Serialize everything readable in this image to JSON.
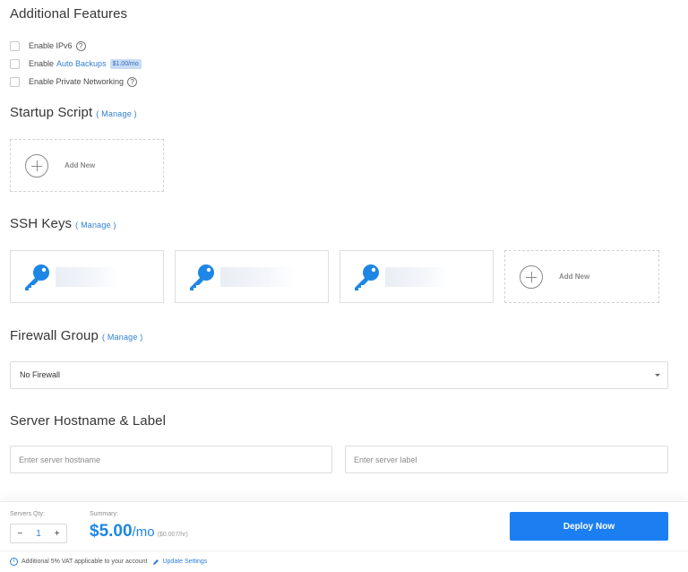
{
  "additional_features": {
    "title": "Additional Features",
    "options": [
      {
        "label": "Enable IPv6",
        "checked": false
      },
      {
        "label_prefix": "Enable",
        "link": "Auto Backups",
        "badge": "$1.00/mo",
        "checked": false
      },
      {
        "label": "Enable Private Networking",
        "checked": false
      }
    ]
  },
  "startup_script": {
    "title": "Startup Script",
    "manage": "( Manage )",
    "add_new": "Add New"
  },
  "ssh_keys": {
    "title": "SSH Keys",
    "manage": "( Manage )",
    "add_new": "Add New",
    "key_count": 3,
    "key_color": "#1e86e5"
  },
  "firewall": {
    "title": "Firewall Group",
    "manage": "( Manage )",
    "selected": "No Firewall"
  },
  "hostname": {
    "title": "Server Hostname & Label",
    "hostname_placeholder": "Enter server hostname",
    "label_placeholder": "Enter server label"
  },
  "footer": {
    "servers_qty_label": "Servers Qty:",
    "qty_minus": "−",
    "qty_value": "1",
    "qty_plus": "+",
    "summary_label": "Summary:",
    "price": "$5.00",
    "price_unit": "/mo",
    "price_hourly": "($0.007/hr)",
    "deploy_label": "Deploy Now",
    "vat_text": "Additional 5% VAT applicable to your account",
    "update_settings": "Update Settings",
    "accent": "#1b7ff1"
  }
}
